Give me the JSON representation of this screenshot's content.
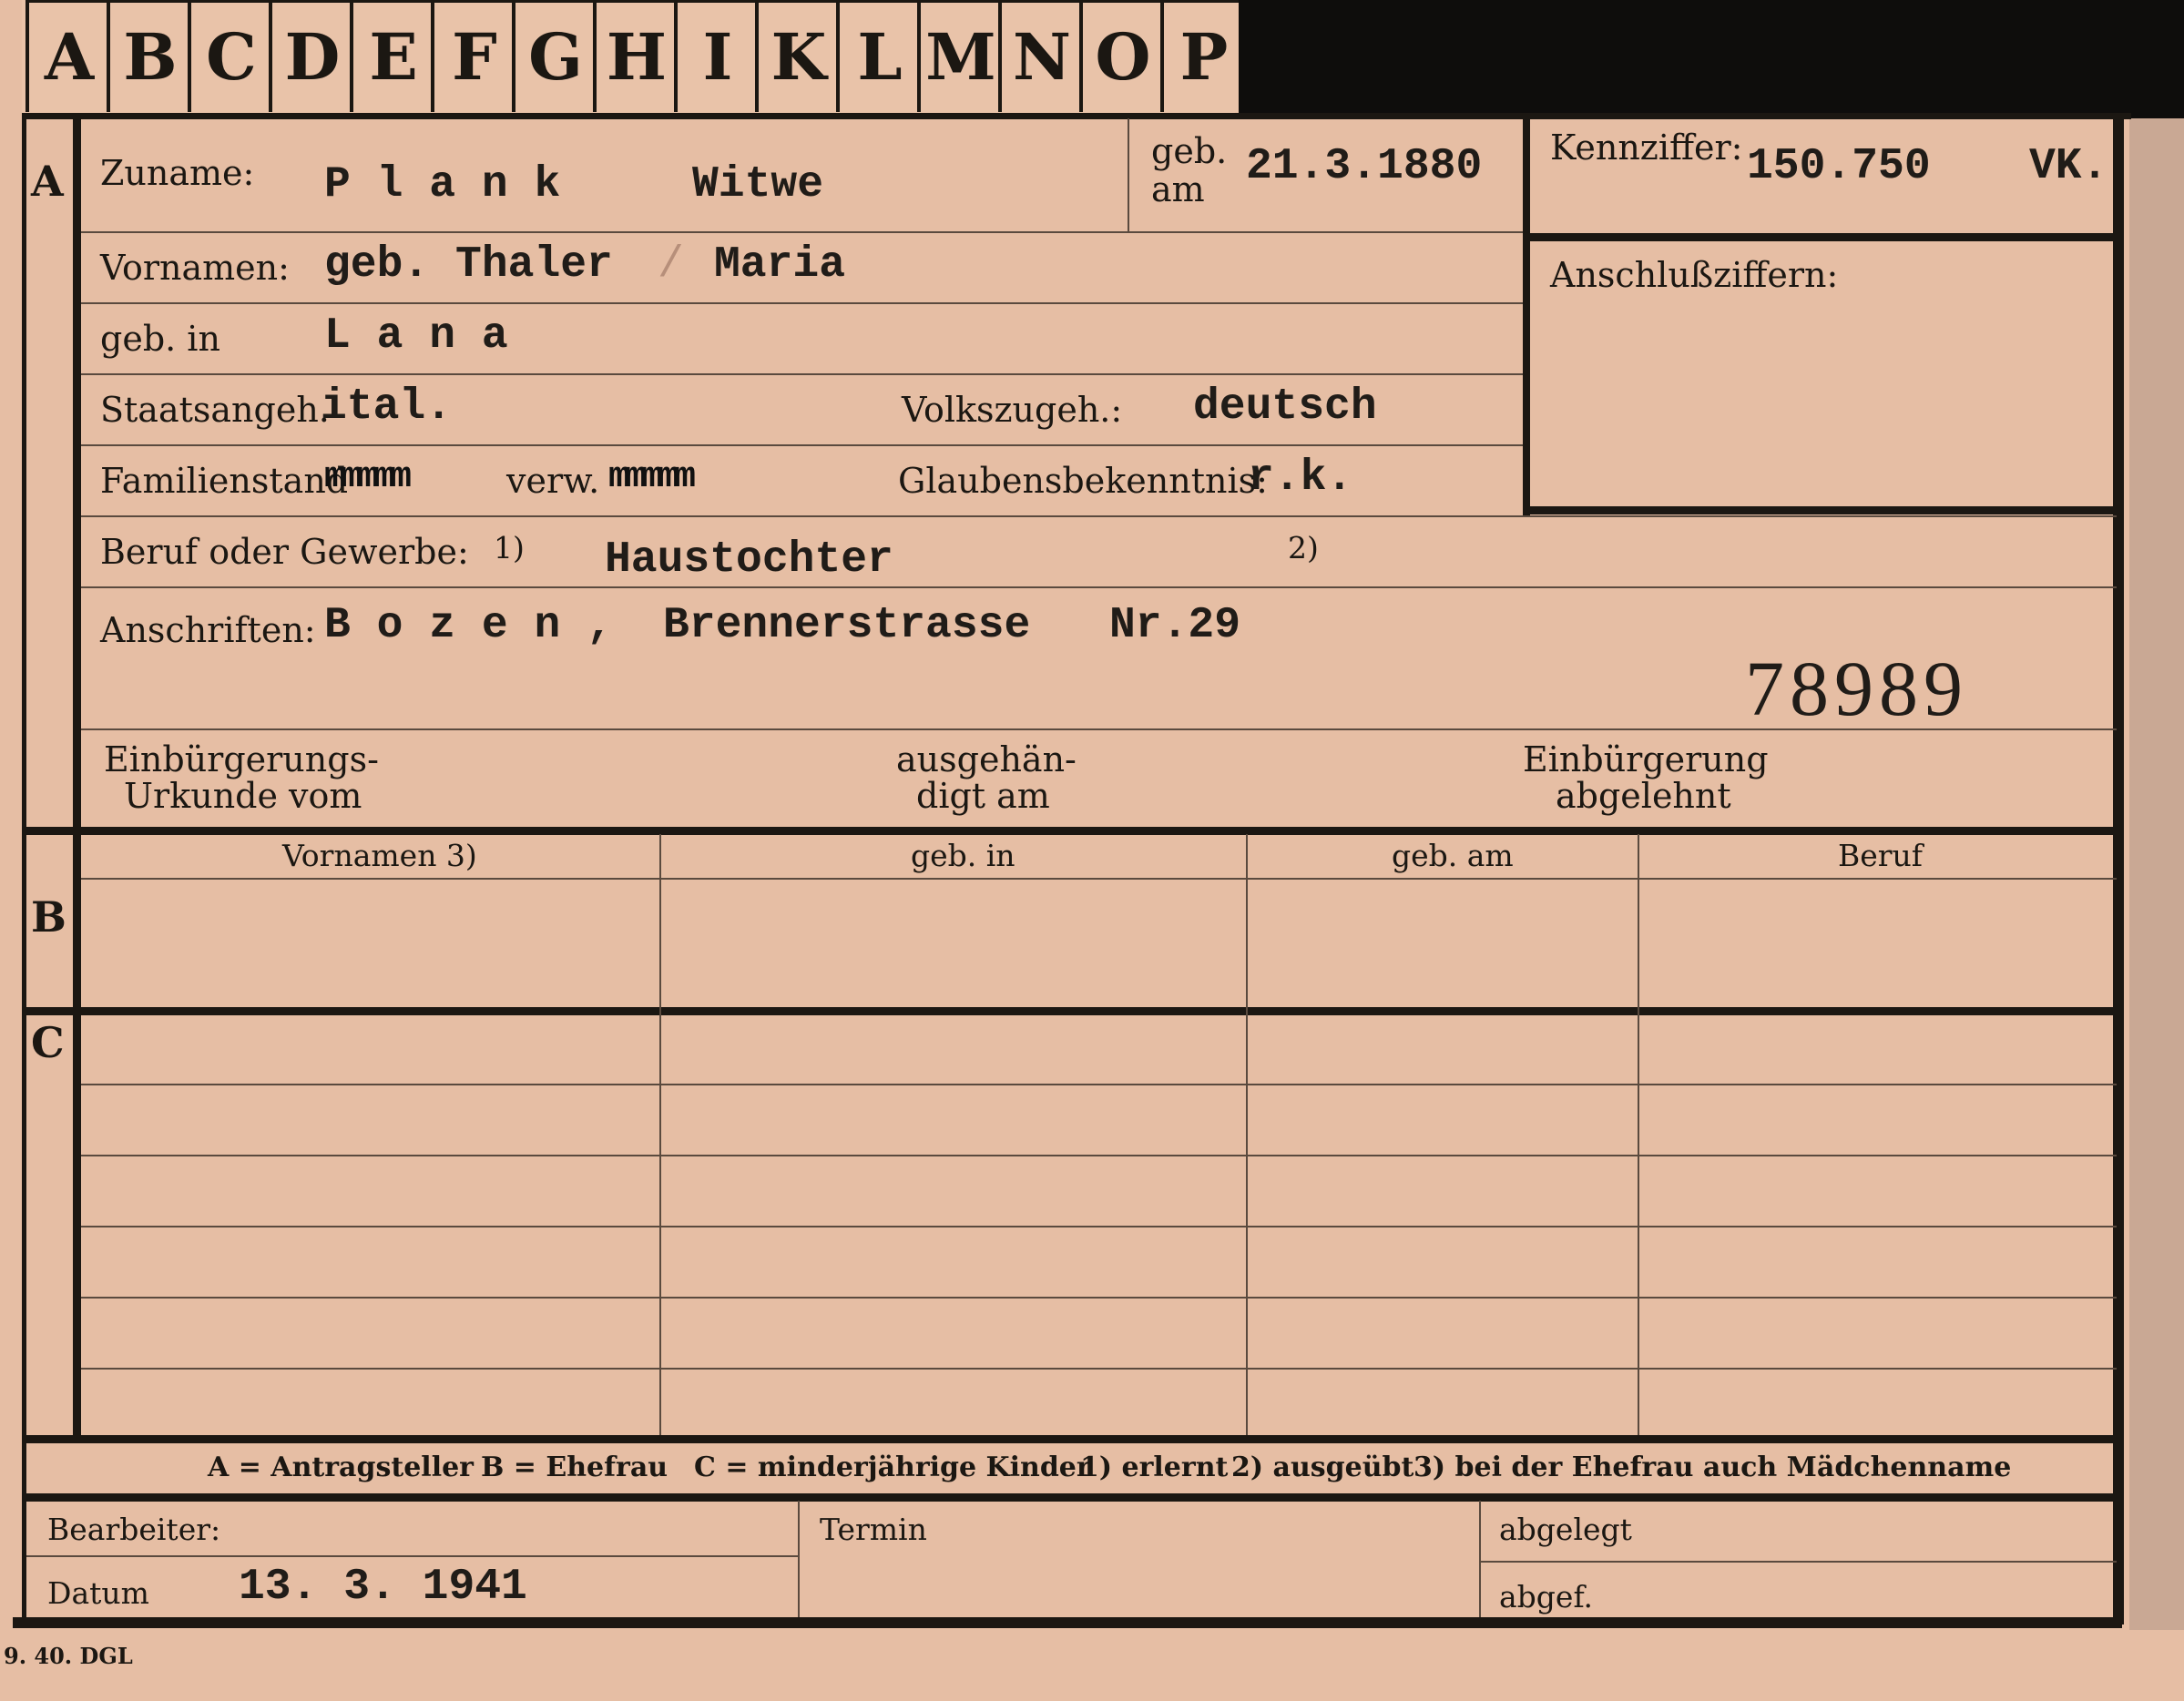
{
  "tabs": [
    "A",
    "B",
    "C",
    "D",
    "E",
    "F",
    "G",
    "H",
    "I",
    "K",
    "L",
    "M",
    "N",
    "O",
    "P"
  ],
  "sections": {
    "a": "A",
    "b": "B",
    "c": "C"
  },
  "fields": {
    "zuname_label": "Zuname:",
    "zuname_value": "P l a n k",
    "zuname_extra": "Witwe",
    "geb_am_label_1": "geb.",
    "geb_am_label_2": "am",
    "geb_am_value": "21.3.1880",
    "kennziffer_label": "Kennziffer:",
    "kennziffer_value": "150.750",
    "kennziffer_suffix": "VK.",
    "anschlussziffern_label": "Anschlußziffern:",
    "vornamen_label": "Vornamen:",
    "vornamen_value_1": "geb. Thaler",
    "vornamen_sep": "/",
    "vornamen_value_2": "Maria",
    "geb_in_label": "geb. in",
    "geb_in_value": "L a n a",
    "staatsangeh_label": "Staatsangeh.",
    "staatsangeh_value": "ital.",
    "volkszugeh_label": "Volkszugeh.:",
    "volkszugeh_value": "deutsch",
    "familienstand_label": "Familienstand",
    "familienstand_strike_1": "mmmmm",
    "familienstand_mid": "verw.",
    "familienstand_strike_2": "mmmmm",
    "glaubens_label": "Glaubensbekenntnis:",
    "glaubens_value": "r.k.",
    "beruf_label": "Beruf oder Gewerbe:",
    "beruf_note1": "1)",
    "beruf_value": "Haustochter",
    "beruf_note2": "2)",
    "anschriften_label": "Anschriften:",
    "anschriften_value_1": "B o z e n ,",
    "anschriften_value_2": "Brennerstrasse",
    "anschriften_value_3": "Nr.29",
    "stamp_number": "78989",
    "einb_urkunde_1": "Einbürgerungs-",
    "einb_urkunde_2": "Urkunde vom",
    "ausgehaendigt_1": "ausgehän-",
    "ausgehaendigt_2": "digt am",
    "einb_abgelehnt_1": "Einbürgerung",
    "einb_abgelehnt_2": "abgelehnt"
  },
  "table": {
    "headers": [
      "Vornamen 3)",
      "geb. in",
      "geb. am",
      "Beruf"
    ]
  },
  "legend": {
    "items": [
      "A = Antragsteller",
      "B = Ehefrau",
      "C = minderjährige Kinder",
      "1) erlernt",
      "2) ausgeübt",
      "3) bei der Ehefrau auch Mädchenname"
    ]
  },
  "footer": {
    "bearbeiter_label": "Bearbeiter:",
    "datum_label": "Datum",
    "datum_value": "13. 3. 1941",
    "termin_label": "Termin",
    "abgelegt_label": "abgelegt",
    "abgef_label": "abgef.",
    "print_code": "9. 40. DGL"
  }
}
